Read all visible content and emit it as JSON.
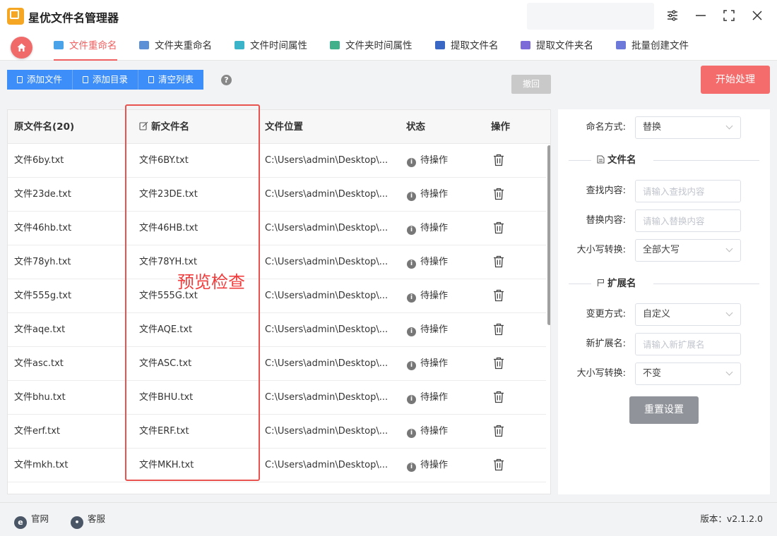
{
  "app": {
    "title": "星优文件名管理器"
  },
  "tabs": [
    {
      "label": "文件重命名",
      "icon": "file-rename-icon",
      "active": true
    },
    {
      "label": "文件夹重命名",
      "icon": "folder-rename-icon"
    },
    {
      "label": "文件时间属性",
      "icon": "file-time-icon"
    },
    {
      "label": "文件夹时间属性",
      "icon": "folder-time-icon"
    },
    {
      "label": "提取文件名",
      "icon": "extract-filename-icon"
    },
    {
      "label": "提取文件夹名",
      "icon": "extract-foldername-icon"
    },
    {
      "label": "批量创建文件",
      "icon": "batch-create-icon"
    }
  ],
  "toolbar": {
    "add_file": "添加文件",
    "add_dir": "添加目录",
    "clear_list": "清空列表",
    "help": "?",
    "undo": "撤回",
    "start": "开始处理"
  },
  "table": {
    "headers": {
      "original": "原文件名(20)",
      "new_name": "新文件名",
      "location": "文件位置",
      "status": "状态",
      "action": "操作"
    },
    "rows": [
      {
        "original": "文件6by.txt",
        "new_name": "文件6BY.txt",
        "location": "C:\\Users\\admin\\Desktop\\...",
        "status": "待操作"
      },
      {
        "original": "文件23de.txt",
        "new_name": "文件23DE.txt",
        "location": "C:\\Users\\admin\\Desktop\\...",
        "status": "待操作"
      },
      {
        "original": "文件46hb.txt",
        "new_name": "文件46HB.txt",
        "location": "C:\\Users\\admin\\Desktop\\...",
        "status": "待操作"
      },
      {
        "original": "文件78yh.txt",
        "new_name": "文件78YH.txt",
        "location": "C:\\Users\\admin\\Desktop\\...",
        "status": "待操作"
      },
      {
        "original": "文件555g.txt",
        "new_name": "文件555G.txt",
        "location": "C:\\Users\\admin\\Desktop\\...",
        "status": "待操作"
      },
      {
        "original": "文件aqe.txt",
        "new_name": "文件AQE.txt",
        "location": "C:\\Users\\admin\\Desktop\\...",
        "status": "待操作"
      },
      {
        "original": "文件asc.txt",
        "new_name": "文件ASC.txt",
        "location": "C:\\Users\\admin\\Desktop\\...",
        "status": "待操作"
      },
      {
        "original": "文件bhu.txt",
        "new_name": "文件BHU.txt",
        "location": "C:\\Users\\admin\\Desktop\\...",
        "status": "待操作"
      },
      {
        "original": "文件erf.txt",
        "new_name": "文件ERF.txt",
        "location": "C:\\Users\\admin\\Desktop\\...",
        "status": "待操作"
      },
      {
        "original": "文件mkh.txt",
        "new_name": "文件MKH.txt",
        "location": "C:\\Users\\admin\\Desktop\\...",
        "status": "待操作"
      }
    ]
  },
  "annotation": {
    "text": "预览检查",
    "color": "#e8524f"
  },
  "settings": {
    "naming_mode_label": "命名方式:",
    "naming_mode_value": "替换",
    "filename_section": "文件名",
    "find_label": "查找内容:",
    "find_placeholder": "请输入查找内容",
    "replace_label": "替换内容:",
    "replace_placeholder": "请输入替换内容",
    "case_label": "大小写转换:",
    "case_value": "全部大写",
    "ext_section": "扩展名",
    "change_mode_label": "变更方式:",
    "change_mode_value": "自定义",
    "new_ext_label": "新扩展名:",
    "new_ext_placeholder": "请输入新扩展名",
    "ext_case_label": "大小写转换:",
    "ext_case_value": "不变",
    "reset": "重置设置"
  },
  "footer": {
    "website": "官网",
    "support": "客服",
    "version": "版本：v2.1.2.0"
  },
  "colors": {
    "accent": "#3d8ef8",
    "brand": "#f56c6c",
    "active_tab": "#f06060"
  }
}
